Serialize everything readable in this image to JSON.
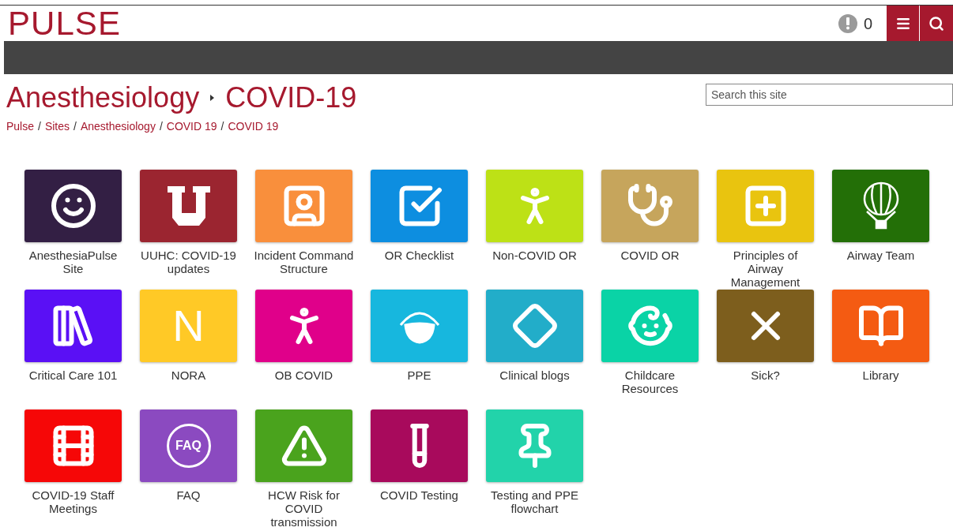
{
  "header": {
    "logo": "PULSE",
    "alert_count": "0"
  },
  "page": {
    "title": "Anesthesiology",
    "subtitle": "COVID-19",
    "breadcrumbs": [
      {
        "label": "Pulse"
      },
      {
        "separator": "/",
        "label": "Sites"
      },
      {
        "separator": "/",
        "label": "Anesthesiology"
      },
      {
        "separator": "/",
        "label": "COVID 19"
      },
      {
        "separator": "/",
        "label": "COVID 19"
      }
    ],
    "search": {
      "placeholder": "Search this site"
    }
  },
  "tiles": [
    {
      "label": "AnesthesiaPulse Site",
      "color": "#331f44"
    },
    {
      "label": "UUHC: COVID-19 updates",
      "color": "#9b2530"
    },
    {
      "label": "Incident Command Structure",
      "color": "#f98f3c"
    },
    {
      "label": "OR Checklist",
      "color": "#0d8ee0"
    },
    {
      "label": "Non-COVID OR",
      "color": "#bde116"
    },
    {
      "label": "COVID OR",
      "color": "#c6a55c"
    },
    {
      "label": "Principles of Airway Management",
      "color": "#e9c40f"
    },
    {
      "label": "Airway Team",
      "color": "#236f07"
    },
    {
      "label": "Critical Care 101",
      "color": "#5a10f5"
    },
    {
      "label": "NORA",
      "icon_text": "N",
      "color": "#ffc926"
    },
    {
      "label": "OB COVID",
      "color": "#e0008a"
    },
    {
      "label": "PPE",
      "color": "#17b7de"
    },
    {
      "label": "Clinical blogs",
      "color": "#22adc9"
    },
    {
      "label": "Childcare Resources",
      "color": "#0ad3a6"
    },
    {
      "label": "Sick?",
      "color": "#7d5e1d"
    },
    {
      "label": "Library",
      "color": "#f45b12"
    },
    {
      "label": "COVID-19 Staff Meetings",
      "color": "#f60707"
    },
    {
      "label": "FAQ",
      "icon_text": "FAQ",
      "color": "#8b4ac0"
    },
    {
      "label": "HCW Risk for COVID transmission",
      "color": "#4aa31d"
    },
    {
      "label": "COVID Testing",
      "color": "#a80a5c"
    },
    {
      "label": "Testing and PPE flowchart",
      "color": "#22d3aa"
    }
  ]
}
